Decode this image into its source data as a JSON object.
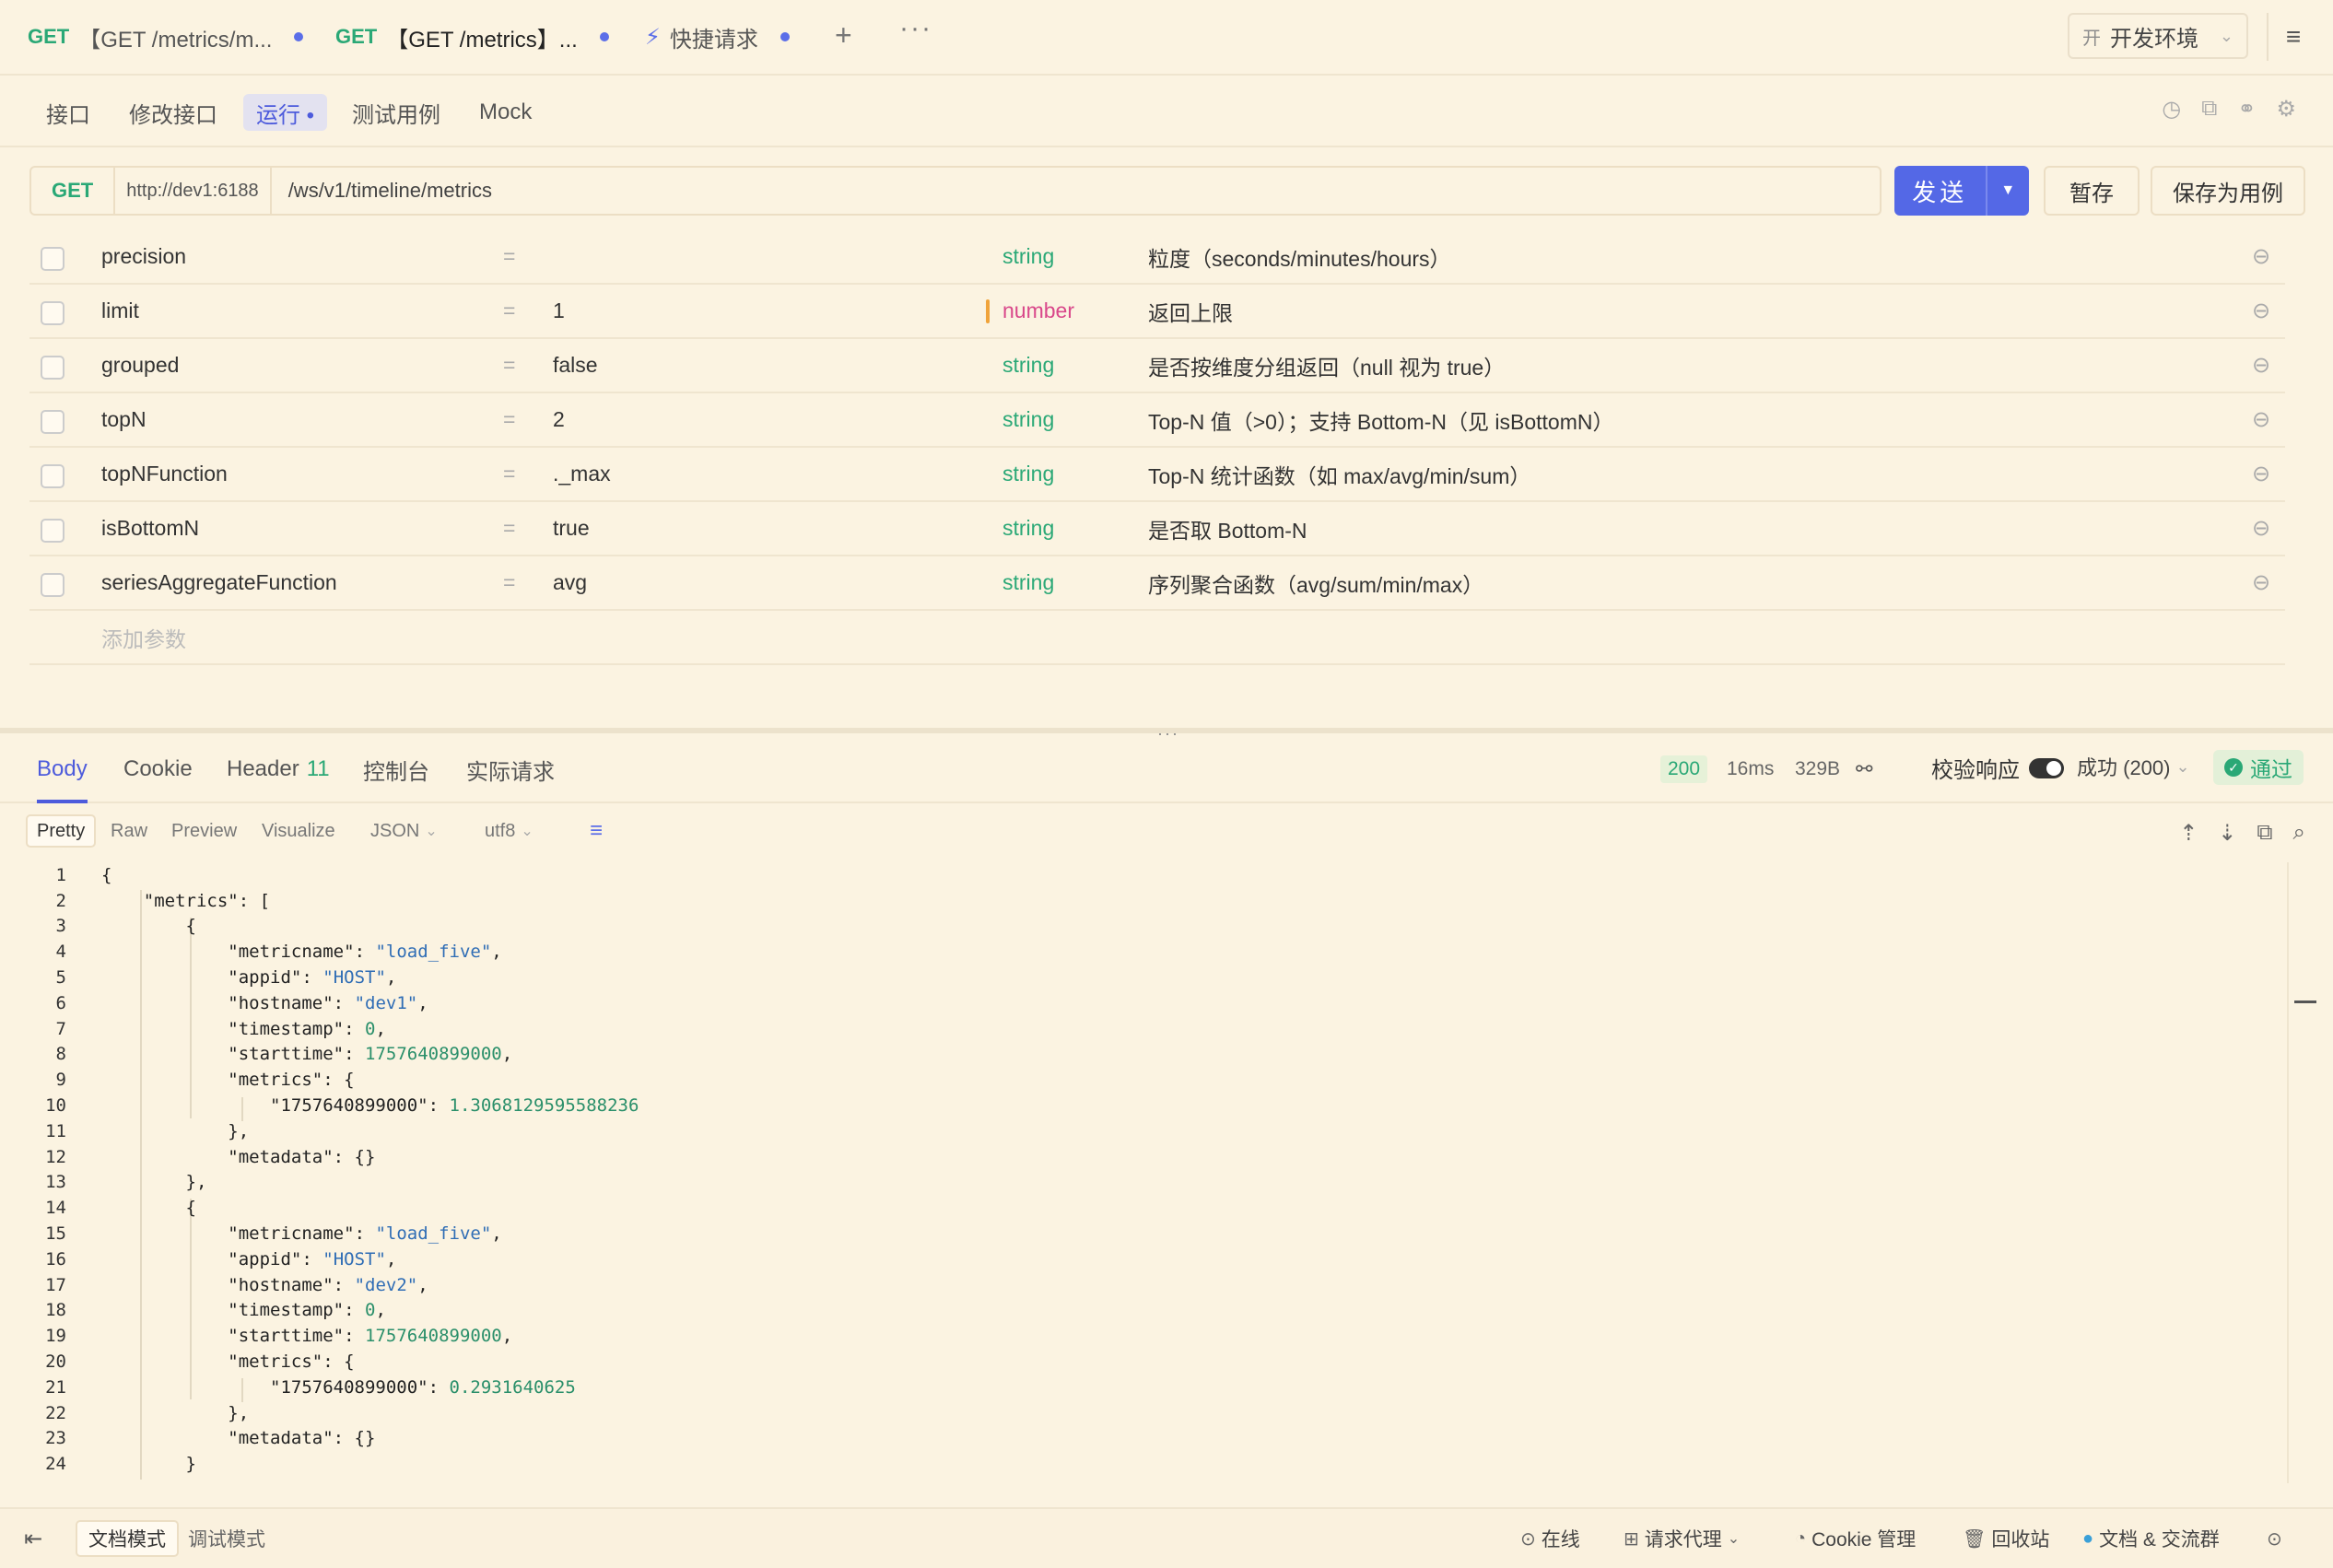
{
  "tabs": [
    {
      "method": "GET",
      "title": "【GET /metrics/m...",
      "active": false
    },
    {
      "method": "GET",
      "title": "【GET /metrics】...",
      "active": true
    },
    {
      "method": "",
      "title": "快捷请求",
      "active": false
    }
  ],
  "env": {
    "icon": "开",
    "label": "开发环境"
  },
  "subtabs": [
    "接口",
    "修改接口",
    "运行 •",
    "测试用例",
    "Mock"
  ],
  "request": {
    "method": "GET",
    "host": "http://dev1:6188",
    "path": "/ws/v1/timeline/metrics",
    "send_label": "发送",
    "save_temp_label": "暂存",
    "save_case_label": "保存为用例"
  },
  "params": [
    {
      "name": "precision",
      "eq": "=",
      "value": "",
      "type": "string",
      "desc": "粒度（seconds/minutes/hours）"
    },
    {
      "name": "limit",
      "eq": "=",
      "value": "1",
      "type": "number",
      "desc": "返回上限"
    },
    {
      "name": "grouped",
      "eq": "=",
      "value": "false",
      "type": "string",
      "desc": "是否按维度分组返回（null 视为 true）"
    },
    {
      "name": "topN",
      "eq": "=",
      "value": "2",
      "type": "string",
      "desc": "Top-N 值（>0）；支持 Bottom-N（见 isBottomN）"
    },
    {
      "name": "topNFunction",
      "eq": "=",
      "value": "._max",
      "type": "string",
      "desc": "Top-N 统计函数（如 max/avg/min/sum）"
    },
    {
      "name": "isBottomN",
      "eq": "=",
      "value": "true",
      "type": "string",
      "desc": "是否取 Bottom-N"
    },
    {
      "name": "seriesAggregateFunction",
      "eq": "=",
      "value": "avg",
      "type": "string",
      "desc": "序列聚合函数（avg/sum/min/max）"
    }
  ],
  "add_param_placeholder": "添加参数",
  "response_tabs": {
    "body": "Body",
    "cookie": "Cookie",
    "header": "Header",
    "header_count": "11",
    "console": "控制台",
    "actual": "实际请求"
  },
  "response_meta": {
    "status": "200",
    "time": "16ms",
    "size": "329B",
    "verify_label": "校验响应",
    "success_label": "成功 (200)",
    "passed_label": "通过"
  },
  "formats": {
    "pretty": "Pretty",
    "raw": "Raw",
    "preview": "Preview",
    "visualize": "Visualize",
    "lang": "JSON",
    "encoding": "utf8"
  },
  "code_lines": [
    "{",
    "    \"metrics\": [",
    "        {",
    "            \"metricname\": \"load_five\",",
    "            \"appid\": \"HOST\",",
    "            \"hostname\": \"dev1\",",
    "            \"timestamp\": 0,",
    "            \"starttime\": 1757640899000,",
    "            \"metrics\": {",
    "                \"1757640899000\": 1.3068129595588236",
    "            },",
    "            \"metadata\": {}",
    "        },",
    "        {",
    "            \"metricname\": \"load_five\",",
    "            \"appid\": \"HOST\",",
    "            \"hostname\": \"dev2\",",
    "            \"timestamp\": 0,",
    "            \"starttime\": 1757640899000,",
    "            \"metrics\": {",
    "                \"1757640899000\": 0.2931640625",
    "            },",
    "            \"metadata\": {}",
    "        }"
  ],
  "statusbar": {
    "doc_mode": "文档模式",
    "debug_mode": "调试模式",
    "online": "在线",
    "proxy": "请求代理",
    "cookie_mgr": "Cookie 管理",
    "trash": "回收站",
    "community": "文档 & 交流群"
  }
}
